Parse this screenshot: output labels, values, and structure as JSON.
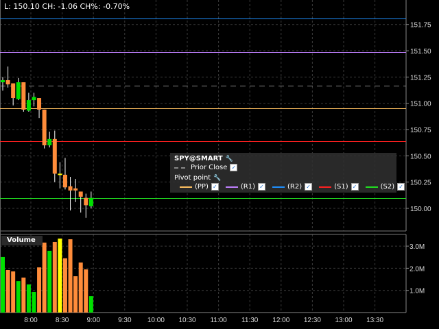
{
  "header": {
    "last_label": "L:",
    "last": "150.10",
    "ch_label": "CH:",
    "ch": "-1.06",
    "chpct_label": "CH%:",
    "chpct": "-0.70%"
  },
  "legend": {
    "symbol": "SPY@SMART",
    "prior_close": "Prior Close",
    "pivot": "Pivot point",
    "items": [
      {
        "label": "(PP)",
        "color": "#ffc060"
      },
      {
        "label": "(R1)",
        "color": "#c080ff"
      },
      {
        "label": "(R2)",
        "color": "#1e90ff"
      },
      {
        "label": "(S1)",
        "color": "#ff2020"
      },
      {
        "label": "(S2)",
        "color": "#20e020"
      }
    ]
  },
  "volume_label": "Volume",
  "chart_data": [
    {
      "type": "candlestick",
      "title": "SPY@SMART",
      "ylim": [
        149.85,
        151.9
      ],
      "y_ticks": [
        "150.00",
        "150.25",
        "150.50",
        "150.75",
        "151.00",
        "151.25",
        "151.50",
        "151.75"
      ],
      "x_ticks": [
        "8:00",
        "8:30",
        "9:00",
        "9:30",
        "10:00",
        "10:30",
        "11:00",
        "11:30",
        "12:00",
        "12:30",
        "13:00",
        "13:30"
      ],
      "candles": [
        {
          "o": 151.2,
          "h": 151.25,
          "l": 151.12,
          "c": 151.22
        },
        {
          "o": 151.22,
          "h": 151.35,
          "l": 151.15,
          "c": 151.18
        },
        {
          "o": 151.19,
          "h": 151.19,
          "l": 150.98,
          "c": 151.05
        },
        {
          "o": 151.04,
          "h": 151.24,
          "l": 151.03,
          "c": 151.2
        },
        {
          "o": 151.2,
          "h": 151.2,
          "l": 150.92,
          "c": 150.94
        },
        {
          "o": 150.93,
          "h": 151.1,
          "l": 150.92,
          "c": 151.03
        },
        {
          "o": 151.03,
          "h": 151.1,
          "l": 150.97,
          "c": 151.06
        },
        {
          "o": 151.05,
          "h": 151.05,
          "l": 150.86,
          "c": 150.94
        },
        {
          "o": 150.94,
          "h": 150.94,
          "l": 150.57,
          "c": 150.6
        },
        {
          "o": 150.6,
          "h": 150.73,
          "l": 150.58,
          "c": 150.66
        },
        {
          "o": 150.66,
          "h": 150.74,
          "l": 150.25,
          "c": 150.33
        },
        {
          "o": 150.33,
          "h": 150.44,
          "l": 150.19,
          "c": 150.32
        },
        {
          "o": 150.32,
          "h": 150.48,
          "l": 150.18,
          "c": 150.2
        },
        {
          "o": 150.21,
          "h": 150.3,
          "l": 149.98,
          "c": 150.17
        },
        {
          "o": 150.19,
          "h": 150.28,
          "l": 150.06,
          "c": 150.17
        },
        {
          "o": 150.16,
          "h": 150.16,
          "l": 149.96,
          "c": 150.11
        },
        {
          "o": 150.1,
          "h": 150.14,
          "l": 149.91,
          "c": 150.03
        },
        {
          "o": 150.02,
          "h": 150.16,
          "l": 150.0,
          "c": 150.1
        }
      ],
      "levels": [
        {
          "name": "R2",
          "value": 151.81,
          "color": "#1e90ff",
          "style": "solid"
        },
        {
          "name": "R1",
          "value": 151.49,
          "color": "#c080ff",
          "style": "solid"
        },
        {
          "name": "Prior Close",
          "value": 151.17,
          "color": "#888888",
          "style": "dashed"
        },
        {
          "name": "PP",
          "value": 150.95,
          "color": "#ffc060",
          "style": "solid"
        },
        {
          "name": "S1",
          "value": 150.64,
          "color": "#ff2020",
          "style": "solid"
        },
        {
          "name": "S2",
          "value": 150.1,
          "color": "#20e020",
          "style": "solid"
        }
      ],
      "colors": {
        "up": "#00e000",
        "down": "#ff8c3a",
        "flat": "#ffff00"
      }
    },
    {
      "type": "bar",
      "title": "Volume",
      "ylim": [
        0,
        3.5
      ],
      "y_ticks": [
        "1.0M",
        "2.0M",
        "3.0M"
      ],
      "values_millions": [
        2.51,
        1.92,
        1.86,
        1.42,
        1.58,
        1.27,
        0.93,
        2.04,
        3.16,
        2.79,
        3.19,
        3.34,
        2.45,
        3.31,
        1.64,
        2.26,
        1.95,
        0.74
      ]
    }
  ]
}
